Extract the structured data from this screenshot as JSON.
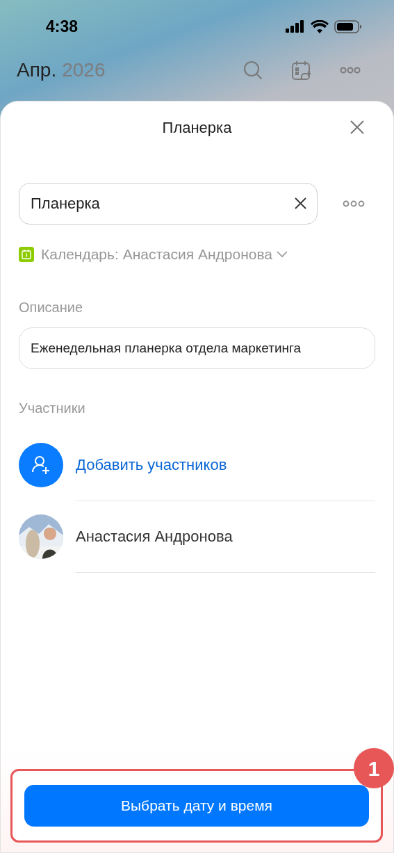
{
  "status_bar": {
    "time": "4:38"
  },
  "header": {
    "month": "Апр.",
    "year": "2026"
  },
  "sheet": {
    "title": "Планерка"
  },
  "title_field": {
    "value": "Планерка"
  },
  "calendar": {
    "label": "Календарь: Анастасия Андронова"
  },
  "description": {
    "label": "Описание",
    "value": "Еженедельная планерка отдела маркетинга"
  },
  "participants": {
    "label": "Участники",
    "items": [
      {
        "kind": "add",
        "name": "Добавить участников"
      },
      {
        "kind": "person",
        "name": "Анастасия Андронова"
      }
    ]
  },
  "primary_button": {
    "label": "Выбрать дату и время"
  },
  "annotation": {
    "badge": "1"
  }
}
